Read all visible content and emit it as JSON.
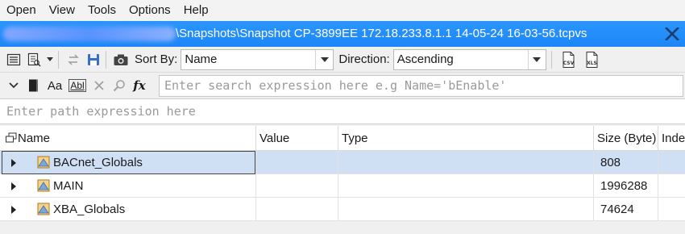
{
  "menu": {
    "items": [
      "Open",
      "View",
      "Tools",
      "Options",
      "Help"
    ]
  },
  "titlebar": {
    "title": "\\Snapshots\\Snapshot CP-3899EE 172.18.233.8.1.1 14-05-24 16-03-56.tcpvs"
  },
  "toolbar": {
    "sort_label": "Sort By:",
    "sort_value": "Name",
    "direction_label": "Direction:",
    "direction_value": "Ascending",
    "csv_label": "CSV",
    "xls_label": "XLS"
  },
  "search": {
    "placeholder": "Enter search expression here e.g Name='bEnable'",
    "aa_label": "Aa",
    "abl_label": "Abl",
    "fx_label": "fx"
  },
  "path": {
    "placeholder": "Enter path expression here"
  },
  "grid": {
    "columns": [
      "Name",
      "Value",
      "Type",
      "Size (Byte)",
      "Inde"
    ],
    "rows": [
      {
        "name": "BACnet_Globals",
        "value": "",
        "type": "",
        "size": "808"
      },
      {
        "name": "MAIN",
        "value": "",
        "type": "",
        "size": "1996288"
      },
      {
        "name": "XBA_Globals",
        "value": "",
        "type": "",
        "size": "74624"
      }
    ]
  },
  "colors": {
    "title_blue": "#1c86f5",
    "selection": "#cfe0f5"
  }
}
